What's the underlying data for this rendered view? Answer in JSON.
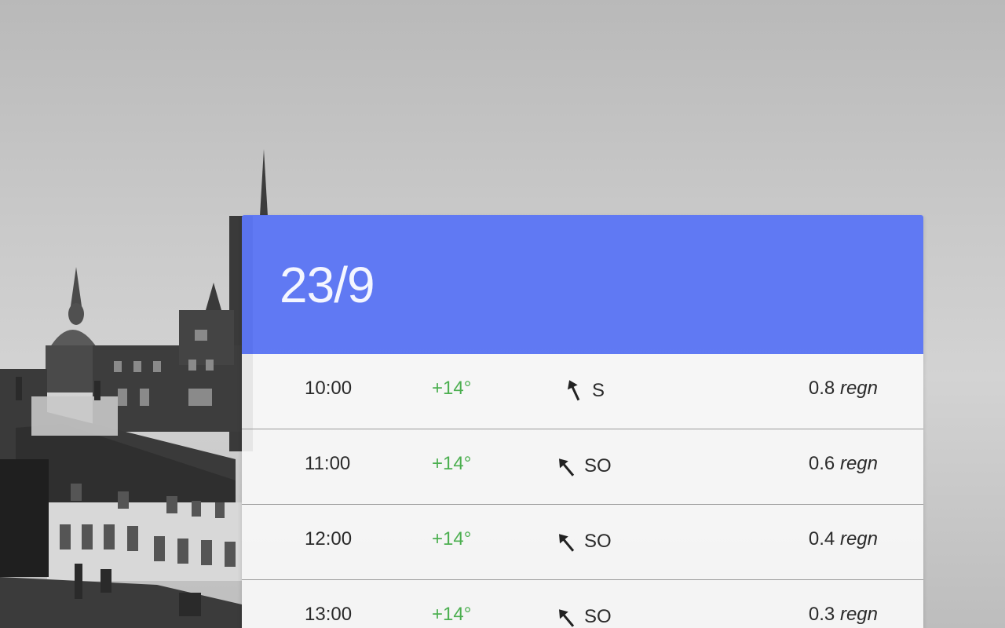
{
  "forecast": {
    "date": "23/9",
    "header_color": "#5c76f5",
    "hours": [
      {
        "time": "10:00",
        "temp": "+14°",
        "wind_dir": "S",
        "wind_icon": "wind-arrow-icon",
        "precip_value": "0.8",
        "precip_type": "regn"
      },
      {
        "time": "11:00",
        "temp": "+14°",
        "wind_dir": "SO",
        "wind_icon": "wind-arrow-icon",
        "precip_value": "0.6",
        "precip_type": "regn"
      },
      {
        "time": "12:00",
        "temp": "+14°",
        "wind_dir": "SO",
        "wind_icon": "wind-arrow-icon",
        "precip_value": "0.4",
        "precip_type": "regn"
      },
      {
        "time": "13:00",
        "temp": "+14°",
        "wind_dir": "SO",
        "wind_icon": "wind-arrow-icon",
        "precip_value": "0.3",
        "precip_type": "regn"
      }
    ]
  },
  "colors": {
    "temperature": "#4caf50"
  }
}
